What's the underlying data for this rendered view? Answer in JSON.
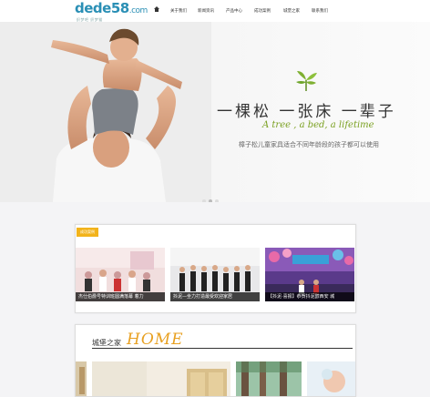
{
  "header": {
    "logo_text": "dede58",
    "logo_domain": ".com",
    "logo_tagline": "织梦吧 织梦猫",
    "nav": [
      {
        "label": ""
      },
      {
        "label": "关于我们"
      },
      {
        "label": "新闻资讯"
      },
      {
        "label": "产品中心"
      },
      {
        "label": "成功案例"
      },
      {
        "label": "城堡之家"
      },
      {
        "label": "联系我们"
      }
    ]
  },
  "banner": {
    "slogan_cn": "一棵松 一张床 一辈子",
    "slogan_en": "A tree , a bed, a lifetime",
    "description": "樟子松儿童家具适合不同年龄段的孩子都可以使用",
    "slide_count": 3,
    "active_slide": 2
  },
  "cases": {
    "tag": "成功案例",
    "items": [
      {
        "caption": "杰仕伯爵号特训班圆满落幕 着力"
      },
      {
        "caption": "抖泥—坐力打造最受欢迎家居"
      },
      {
        "caption": "【抖泥·喜报】恭贺抖泥醇西安 城"
      }
    ]
  },
  "home_section": {
    "title_cn": "城堡之家",
    "title_en": "HOME"
  },
  "colors": {
    "accent": "#f2b31b",
    "brand": "#2a8fb5",
    "slogan_en": "#7aa020"
  }
}
